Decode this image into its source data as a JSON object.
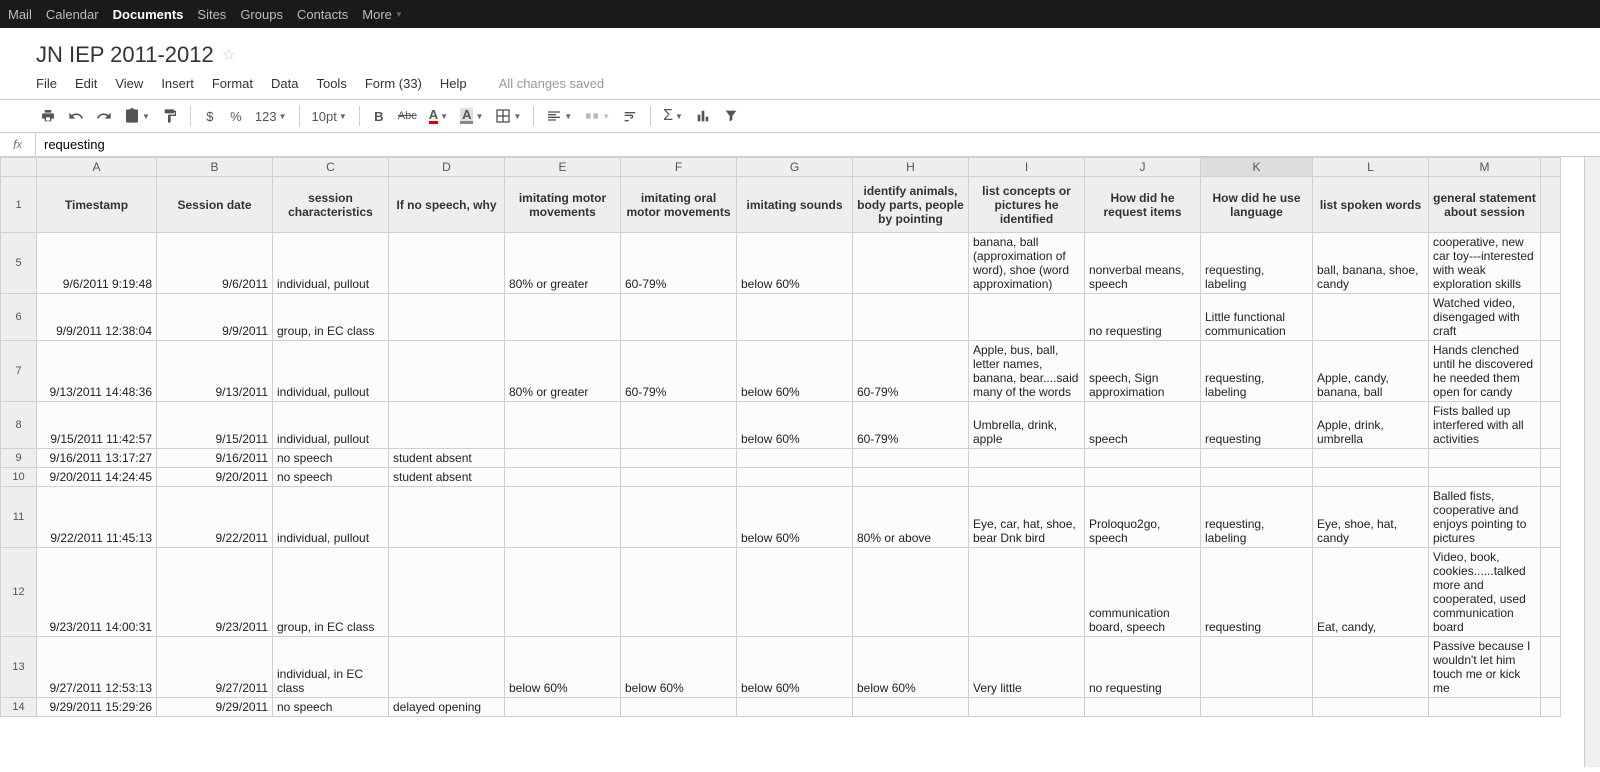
{
  "topnav": {
    "items": [
      "Mail",
      "Calendar",
      "Documents",
      "Sites",
      "Groups",
      "Contacts"
    ],
    "active": "Documents",
    "more": "More"
  },
  "title": "JN IEP 2011-2012",
  "menus": [
    "File",
    "Edit",
    "View",
    "Insert",
    "Format",
    "Data",
    "Tools",
    "Form (33)",
    "Help"
  ],
  "saved_status": "All changes saved",
  "toolbar": {
    "font_size": "10pt",
    "num_dropdown": "123",
    "dollar": "$",
    "percent": "%",
    "bold": "B",
    "strike": "Abc",
    "textcolor": "A",
    "fillcolor": "A"
  },
  "formula": "requesting",
  "columns": [
    "A",
    "B",
    "C",
    "D",
    "E",
    "F",
    "G",
    "H",
    "I",
    "J",
    "K",
    "L",
    "M",
    ""
  ],
  "selected_column": "K",
  "header_row_number": "1",
  "headers": [
    "Timestamp",
    "Session date",
    "session characteristics",
    "If no speech, why",
    "imitating motor movements",
    "imitating oral motor movements",
    "imitating sounds",
    "identify animals, body parts, people by pointing",
    "list concepts or pictures he identified",
    "How did he request items",
    "How did he use language",
    "list spoken words",
    "general statement about session"
  ],
  "rows": [
    {
      "n": "5",
      "cells": [
        "9/6/2011 9:19:48",
        "9/6/2011",
        "individual, pullout",
        "",
        "80% or greater",
        "60-79%",
        "below 60%",
        "",
        "banana, ball (approximation of word), shoe (word approximation)",
        "nonverbal means, speech",
        "requesting, labeling",
        "ball, banana, shoe, candy",
        "cooperative, new car toy---interested with weak exploration skills"
      ]
    },
    {
      "n": "6",
      "cells": [
        "9/9/2011 12:38:04",
        "9/9/2011",
        "group, in EC class",
        "",
        "",
        "",
        "",
        "",
        "",
        "no requesting",
        "Little functional communication",
        "",
        "Watched video, disengaged with craft"
      ]
    },
    {
      "n": "7",
      "cells": [
        "9/13/2011 14:48:36",
        "9/13/2011",
        "individual, pullout",
        "",
        "80% or greater",
        "60-79%",
        "below 60%",
        "60-79%",
        "Apple, bus, ball, letter names, banana, bear....said many of the words",
        "speech, Sign approximation",
        "requesting, labeling",
        "Apple, candy, banana, ball",
        "Hands clenched until he discovered he needed them open for candy"
      ]
    },
    {
      "n": "8",
      "cells": [
        "9/15/2011 11:42:57",
        "9/15/2011",
        "individual, pullout",
        "",
        "",
        "",
        "below 60%",
        "60-79%",
        "Umbrella, drink, apple",
        "speech",
        "requesting",
        "Apple, drink, umbrella",
        "Fists balled up interfered with all activities"
      ]
    },
    {
      "n": "9",
      "cells": [
        "9/16/2011 13:17:27",
        "9/16/2011",
        "no speech",
        "student absent",
        "",
        "",
        "",
        "",
        "",
        "",
        "",
        "",
        ""
      ]
    },
    {
      "n": "10",
      "cells": [
        "9/20/2011 14:24:45",
        "9/20/2011",
        "no speech",
        "student absent",
        "",
        "",
        "",
        "",
        "",
        "",
        "",
        "",
        ""
      ]
    },
    {
      "n": "11",
      "cells": [
        "9/22/2011 11:45:13",
        "9/22/2011",
        "individual, pullout",
        "",
        "",
        "",
        "below 60%",
        "80% or above",
        "Eye, car, hat, shoe, bear\nDnk bird",
        "Proloquo2go, speech",
        "requesting, labeling",
        "Eye, shoe, hat, candy",
        "Balled fists, cooperative and enjoys pointing to pictures"
      ]
    },
    {
      "n": "12",
      "cells": [
        "9/23/2011 14:00:31",
        "9/23/2011",
        "group, in EC class",
        "",
        "",
        "",
        "",
        "",
        "",
        "communication board, speech",
        "requesting",
        "Eat, candy,",
        "Video, book, cookies......talked more and cooperated, used communication board"
      ]
    },
    {
      "n": "13",
      "cells": [
        "9/27/2011 12:53:13",
        "9/27/2011",
        "individual, in EC class",
        "",
        "below 60%",
        "below 60%",
        "below 60%",
        "below 60%",
        "Very little",
        "no requesting",
        "",
        "",
        "Passive because I wouldn't let him touch me or kick me"
      ]
    },
    {
      "n": "14",
      "cells": [
        "9/29/2011 15:29:26",
        "9/29/2011",
        "no speech",
        "delayed opening",
        "",
        "",
        "",
        "",
        "",
        "",
        "",
        "",
        ""
      ]
    }
  ]
}
